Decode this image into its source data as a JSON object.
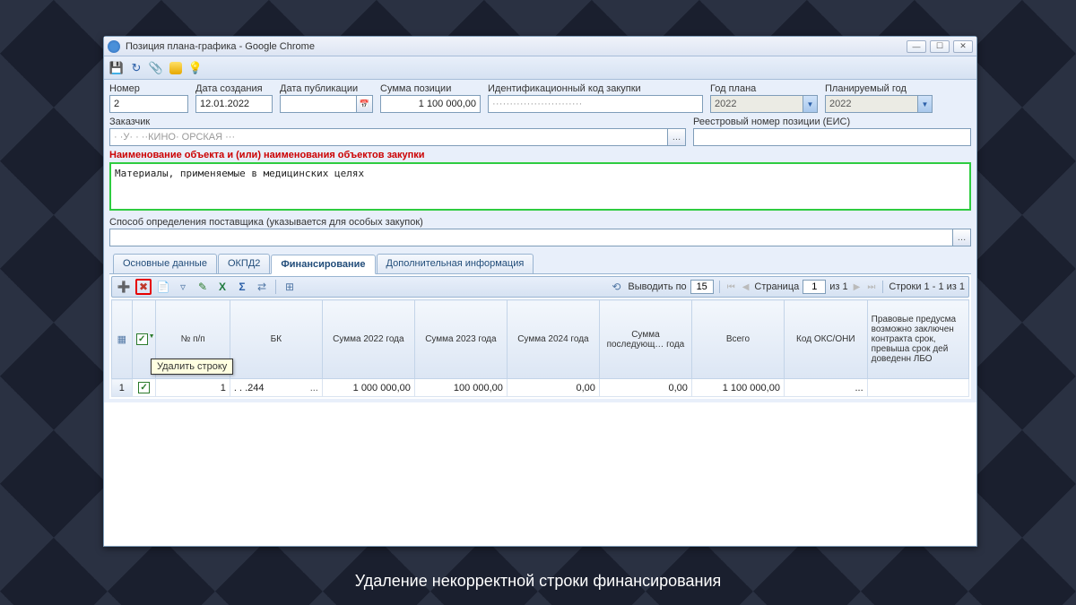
{
  "window": {
    "title": "Позиция плана-графика - Google Chrome"
  },
  "form": {
    "number_label": "Номер",
    "number_value": "2",
    "create_date_label": "Дата создания",
    "create_date_value": "12.01.2022",
    "pub_date_label": "Дата публикации",
    "pub_date_value": "",
    "sum_label": "Сумма позиции",
    "sum_value": "1 100 000,00",
    "ik_label": "Идентификационный код закупки",
    "ik_value": "··························",
    "plan_year_label": "Год плана",
    "plan_year_value": "2022",
    "planned_year_label": "Планируемый год",
    "planned_year_value": "2022",
    "customer_label": "Заказчик",
    "customer_value": "· ·У· · ··КИНО· ОРСКАЯ ···",
    "eis_label": "Реестровый номер позиции (ЕИС)",
    "eis_value": "",
    "object_label": "Наименование объекта и (или) наименования объектов закупки",
    "object_value": "Материалы, применяемые в медицинских целях",
    "supplier_label": "Способ определения поставщика (указывается для особых закупок)",
    "supplier_value": ""
  },
  "tabs": {
    "t1": "Основные данные",
    "t2": "ОКПД2",
    "t3": "Финансирование",
    "t4": "Дополнительная информация"
  },
  "tooltip": "Удалить строку",
  "pager": {
    "output_label": "Выводить по",
    "output_value": "15",
    "page_label": "Страница",
    "page_value": "1",
    "page_of": "из 1",
    "rows_label": "Строки 1 - 1 из 1"
  },
  "grid": {
    "headers": {
      "npp": "№ п/п",
      "bk": "БК",
      "sum2022": "Сумма 2022 года",
      "sum2023": "Сумма 2023 года",
      "sum2024": "Сумма 2024 года",
      "sum_next": "Сумма последующ… года",
      "total": "Всего",
      "oks": "Код ОКС/ОНИ",
      "legal": "Правовые предусма возможно заключен контракта срок, превыша срок дей доведенн ЛБО"
    },
    "rows": [
      {
        "rownum": "1",
        "checked": true,
        "npp": "1",
        "bk": ". . .244",
        "bk_ell": "...",
        "sum2022": "1 000 000,00",
        "sum2023": "100 000,00",
        "sum2024": "0,00",
        "sum_next": "0,00",
        "total": "1 100 000,00",
        "oks": "...",
        "legal": ""
      }
    ]
  },
  "caption": "Удаление некорректной строки финансирования"
}
